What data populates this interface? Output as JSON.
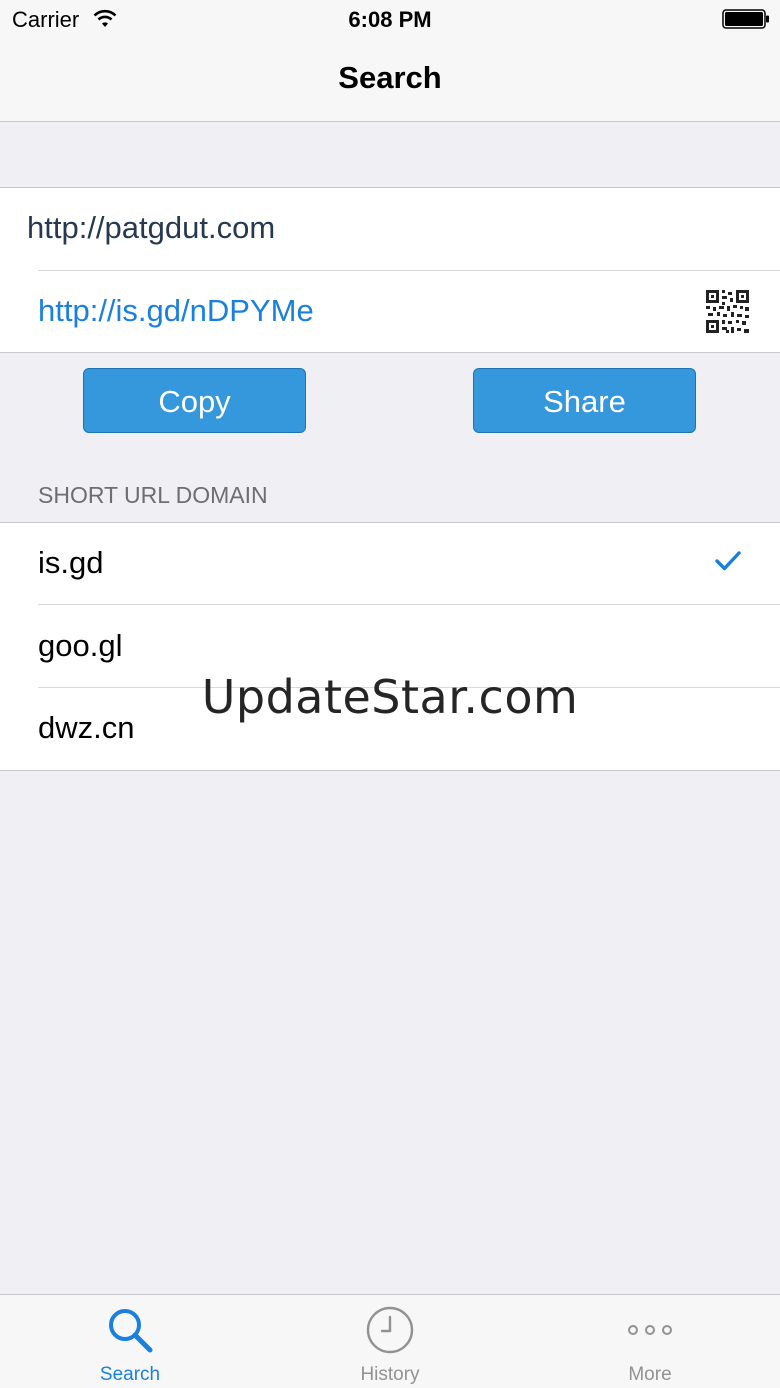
{
  "status_bar": {
    "carrier": "Carrier",
    "time": "6:08 PM",
    "wifi_icon": "wifi-icon",
    "battery_icon": "battery-icon"
  },
  "nav": {
    "title": "Search"
  },
  "url_group": {
    "long_url": "http://patgdut.com",
    "short_url": "http://is.gd/nDPYMe",
    "qr_icon": "qr-code-icon"
  },
  "actions": {
    "copy_label": "Copy",
    "share_label": "Share"
  },
  "domain_section": {
    "header": "SHORT URL DOMAIN",
    "items": [
      {
        "label": "is.gd",
        "selected": true
      },
      {
        "label": "goo.gl",
        "selected": false
      },
      {
        "label": "dwz.cn",
        "selected": false
      }
    ],
    "check_icon": "checkmark-icon"
  },
  "watermark": "UpdateStar.com",
  "tabs": [
    {
      "label": "Search",
      "icon": "magnifier-icon",
      "active": true
    },
    {
      "label": "History",
      "icon": "clock-icon",
      "active": false
    },
    {
      "label": "More",
      "icon": "more-dots-icon",
      "active": false
    }
  ],
  "colors": {
    "accent": "#1a80e0",
    "button_fill": "#3597dc",
    "background": "#efeff4",
    "tab_inactive": "#929292"
  }
}
